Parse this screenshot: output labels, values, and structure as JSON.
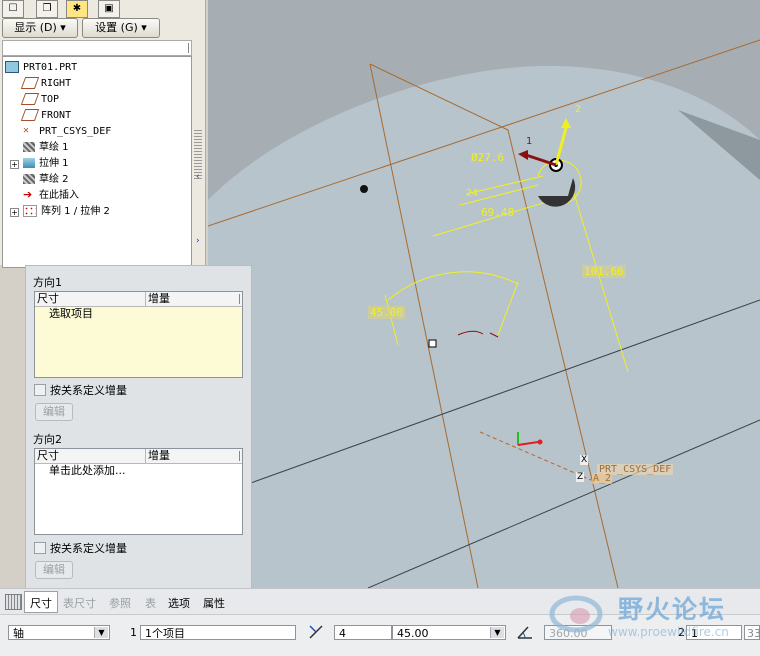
{
  "toolbar": {
    "show_label": "显示 (D)",
    "settings_label": "设置 (G)"
  },
  "tree": {
    "items": [
      {
        "label": "PRT01.PRT"
      },
      {
        "label": "RIGHT"
      },
      {
        "label": "TOP"
      },
      {
        "label": "FRONT"
      },
      {
        "label": "PRT_CSYS_DEF"
      },
      {
        "label": "草绘 1"
      },
      {
        "label": "拉伸 1"
      },
      {
        "label": "草绘 2"
      },
      {
        "label": "在此插入"
      },
      {
        "label": "阵列 1 / 拉伸 2"
      }
    ]
  },
  "viewport": {
    "dim_diameter": "Ø27.6",
    "dim_24": "24",
    "dim_6948": "69.48",
    "dim_10166": "101.66",
    "dim_angle": "45.00",
    "axis_label_2": "2",
    "axis_label_1": "1",
    "csys_label": "PRT_CSYS_DEF",
    "axis_name": "A_2",
    "csys_x": "X",
    "csys_z": "Z"
  },
  "pattern": {
    "dir1_title": "方向1",
    "dir2_title": "方向2",
    "col_dim": "尺寸",
    "col_inc": "增量",
    "dir1_row": "选取项目",
    "dir2_row": "单击此处添加...",
    "checkbox_label": "按关系定义增量",
    "edit_label": "编辑"
  },
  "dashboard": {
    "tabs": [
      "尺寸",
      "表尺寸",
      "参照",
      "表",
      "选项",
      "属性"
    ],
    "type_value": "轴",
    "dir1_num": "1",
    "dir1_items": "1个项目",
    "count_value": "4",
    "angle_value": "45.00",
    "total_angle": "360.00",
    "dir2_num": "2",
    "dir2_count": "1",
    "right_value": "33"
  },
  "watermark": {
    "cn": "野火论坛",
    "url": "www.proewildfire.cn"
  },
  "colors": {
    "model": "#aeb5bb",
    "datum": "#b0642a",
    "dimension": "#f2f226",
    "list_bg": "#fdfbd6"
  }
}
